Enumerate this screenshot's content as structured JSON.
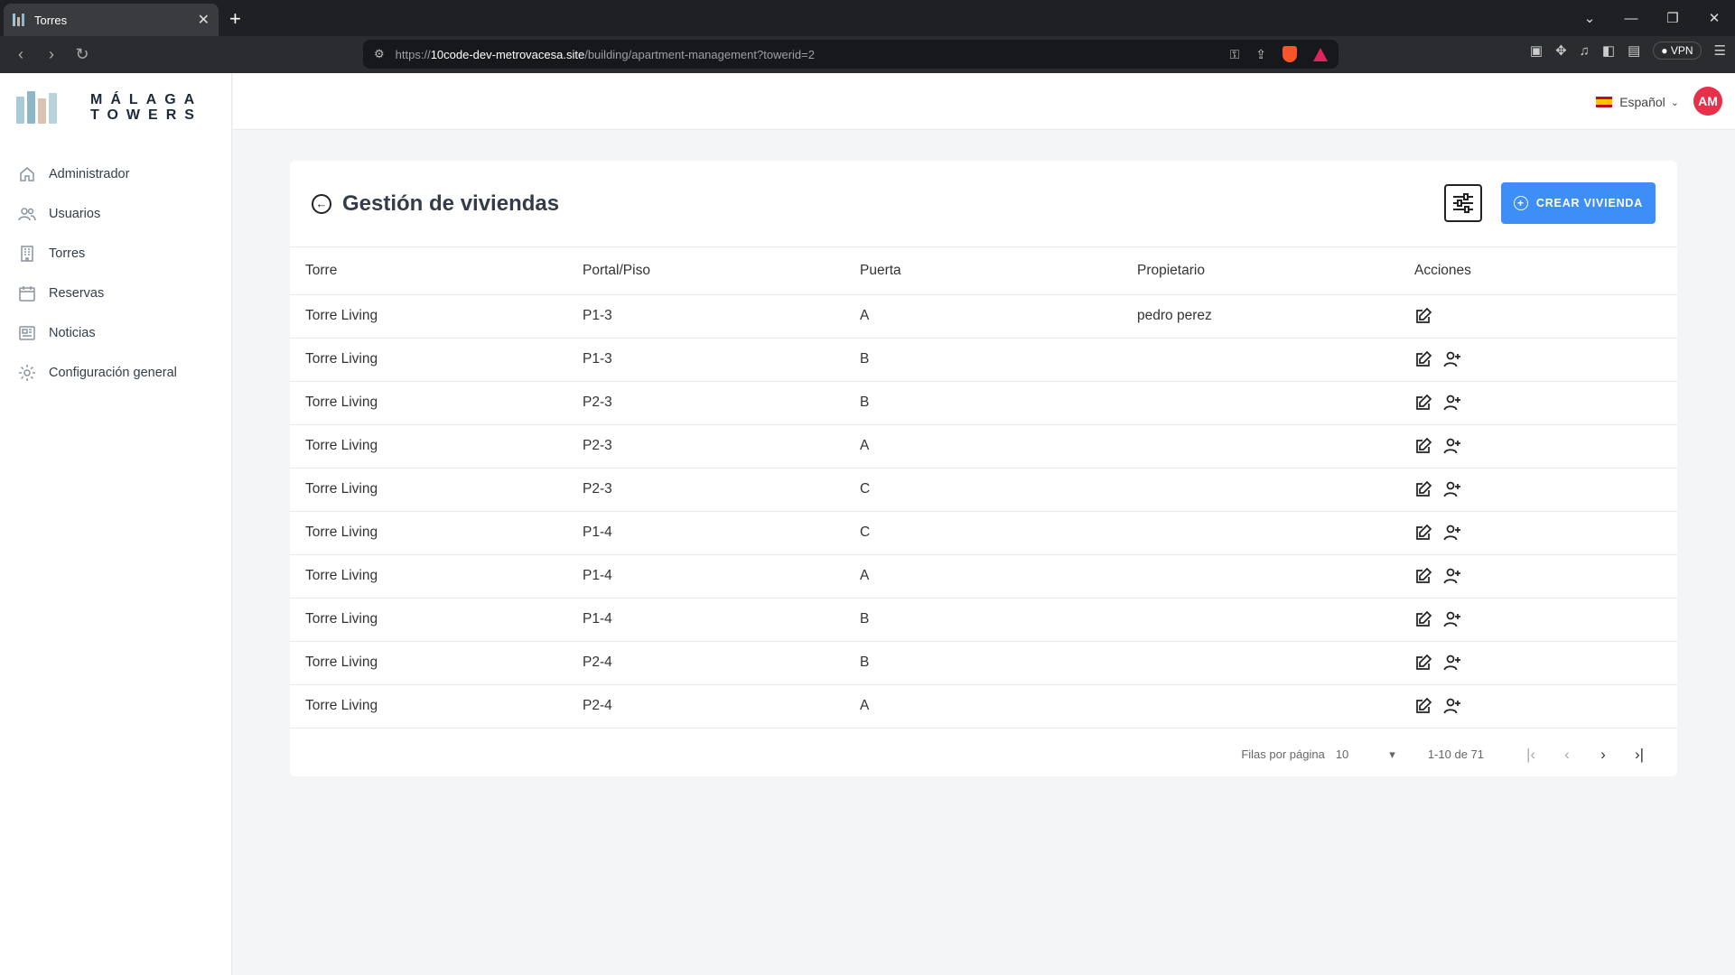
{
  "browser": {
    "tab_title": "Torres",
    "new_tab": "+",
    "url_scheme": "https://",
    "url_host": "10code-dev-metrovacesa.site",
    "url_path": "/building/apartment-management?towerid=2",
    "vpn_label": "VPN"
  },
  "brand": {
    "line1": "MÁLAGA",
    "line2": "TOWERS"
  },
  "sidebar": {
    "items": [
      {
        "label": "Administrador",
        "icon": "home-icon"
      },
      {
        "label": "Usuarios",
        "icon": "users-icon"
      },
      {
        "label": "Torres",
        "icon": "building-icon"
      },
      {
        "label": "Reservas",
        "icon": "calendar-icon"
      },
      {
        "label": "Noticias",
        "icon": "news-icon"
      },
      {
        "label": "Configuración general",
        "icon": "gear-icon"
      }
    ]
  },
  "header": {
    "language": "Español",
    "avatar_initials": "AM"
  },
  "main": {
    "title": "Gestión de viviendas",
    "create_button": "CREAR VIVIENDA",
    "columns": [
      "Torre",
      "Portal/Piso",
      "Puerta",
      "Propietario",
      "Acciones"
    ],
    "rows": [
      {
        "torre": "Torre Living",
        "piso": "P1-3",
        "puerta": "A",
        "propietario": "pedro perez",
        "assign": false
      },
      {
        "torre": "Torre Living",
        "piso": "P1-3",
        "puerta": "B",
        "propietario": "",
        "assign": true
      },
      {
        "torre": "Torre Living",
        "piso": "P2-3",
        "puerta": "B",
        "propietario": "",
        "assign": true
      },
      {
        "torre": "Torre Living",
        "piso": "P2-3",
        "puerta": "A",
        "propietario": "",
        "assign": true
      },
      {
        "torre": "Torre Living",
        "piso": "P2-3",
        "puerta": "C",
        "propietario": "",
        "assign": true
      },
      {
        "torre": "Torre Living",
        "piso": "P1-4",
        "puerta": "C",
        "propietario": "",
        "assign": true
      },
      {
        "torre": "Torre Living",
        "piso": "P1-4",
        "puerta": "A",
        "propietario": "",
        "assign": true
      },
      {
        "torre": "Torre Living",
        "piso": "P1-4",
        "puerta": "B",
        "propietario": "",
        "assign": true
      },
      {
        "torre": "Torre Living",
        "piso": "P2-4",
        "puerta": "B",
        "propietario": "",
        "assign": true
      },
      {
        "torre": "Torre Living",
        "piso": "P2-4",
        "puerta": "A",
        "propietario": "",
        "assign": true
      }
    ],
    "pagination": {
      "rows_label": "Filas por página",
      "rows_value": "10",
      "range": "1-10 de 71"
    }
  },
  "colors": {
    "accent": "#3e8ef7",
    "avatar": "#e8304a"
  }
}
